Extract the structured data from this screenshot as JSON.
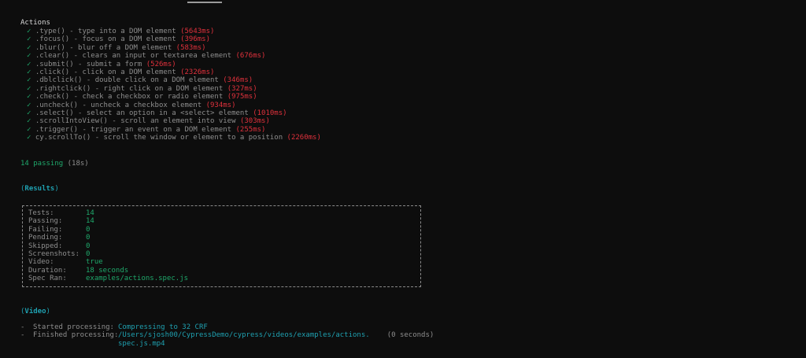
{
  "suite": {
    "title": "Actions",
    "check_glyph": "✓",
    "tests": [
      {
        "name": ".type() - type into a DOM element",
        "duration": "(5643ms)"
      },
      {
        "name": ".focus() - focus on a DOM element",
        "duration": "(396ms)"
      },
      {
        "name": ".blur() - blur off a DOM element",
        "duration": "(583ms)"
      },
      {
        "name": ".clear() - clears an input or textarea element",
        "duration": "(676ms)"
      },
      {
        "name": ".submit() - submit a form",
        "duration": "(526ms)"
      },
      {
        "name": ".click() - click on a DOM element",
        "duration": "(2326ms)"
      },
      {
        "name": ".dblclick() - double click on a DOM element",
        "duration": "(346ms)"
      },
      {
        "name": ".rightclick() - right click on a DOM element",
        "duration": "(327ms)"
      },
      {
        "name": ".check() - check a checkbox or radio element",
        "duration": "(975ms)"
      },
      {
        "name": ".uncheck() - uncheck a checkbox element",
        "duration": "(934ms)"
      },
      {
        "name": ".select() - select an option in a <select> element",
        "duration": "(1010ms)"
      },
      {
        "name": ".scrollIntoView() - scroll an element into view",
        "duration": "(303ms)"
      },
      {
        "name": ".trigger() - trigger an event on a DOM element",
        "duration": "(255ms)"
      },
      {
        "name": "cy.scrollTo() - scroll the window or element to a position",
        "duration": "(2260ms)"
      }
    ]
  },
  "summary": {
    "passing": "14 passing",
    "time": "(18s)"
  },
  "results": {
    "heading_open": "(",
    "heading": "Results",
    "heading_close": ")",
    "rows": [
      {
        "label": "Tests:",
        "value": "14"
      },
      {
        "label": "Passing:",
        "value": "14"
      },
      {
        "label": "Failing:",
        "value": "0"
      },
      {
        "label": "Pending:",
        "value": "0"
      },
      {
        "label": "Skipped:",
        "value": "0"
      },
      {
        "label": "Screenshots:",
        "value": "0"
      },
      {
        "label": "Video:",
        "value": "true"
      },
      {
        "label": "Duration:",
        "value": "18 seconds"
      },
      {
        "label": "Spec Ran:",
        "value": "examples/actions.spec.js"
      }
    ]
  },
  "video": {
    "heading_open": "(",
    "heading": "Video",
    "heading_close": ")",
    "bullet": "-",
    "started_label": "Started processing:",
    "started_value": "Compressing to 32 CRF",
    "finished_label": "Finished processing:",
    "finished_value_line1": "/Users/sjosh00/CypressDemo/cypress/videos/examples/actions.",
    "finished_time": "(0 seconds)",
    "finished_value_line2": "spec.js.mp4"
  },
  "colors": {
    "background": "#0d0d0d",
    "pass_green": "#1fa86b",
    "duration_red": "#e0313c",
    "section_cyan": "#1fa0b0",
    "muted_grey": "#8e8e8e"
  }
}
